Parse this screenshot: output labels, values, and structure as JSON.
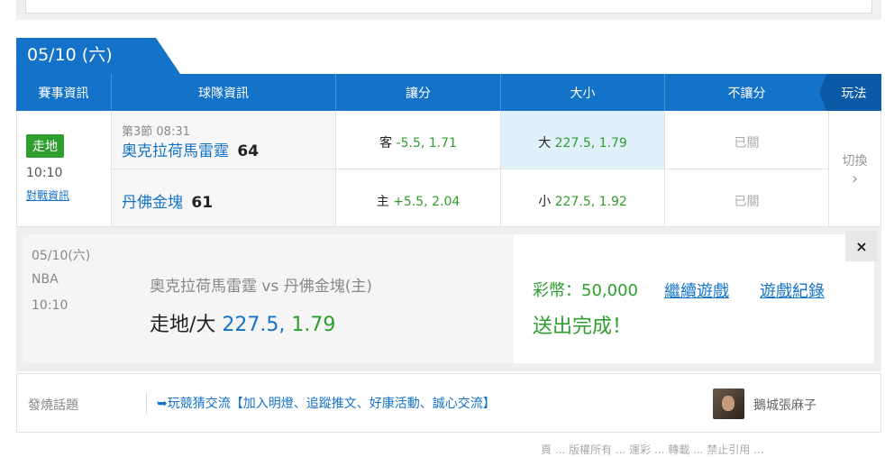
{
  "date_tab": "05/10 (六)",
  "headers": {
    "event_info": "賽事資訊",
    "team_info": "球隊資訊",
    "spread": "讓分",
    "over_under": "大小",
    "moneyline": "不讓分",
    "play": "玩法"
  },
  "match": {
    "status_badge": "走地",
    "time": "10:10",
    "matchup_link": "對戰資訊",
    "period": "第3節 08:31",
    "away": {
      "name": "奧克拉荷馬雷霆",
      "score": "64"
    },
    "home": {
      "name": "丹佛金塊",
      "score": "61"
    },
    "spread_away": {
      "label": "客",
      "value": "-5.5, 1.71"
    },
    "spread_home": {
      "label": "主",
      "value": "+5.5, 2.04"
    },
    "ou_over": {
      "label": "大",
      "value": "227.5, 1.79"
    },
    "ou_under": {
      "label": "小",
      "value": "227.5, 1.92"
    },
    "ml_away": "已關",
    "ml_home": "已關",
    "switch_label": "切換",
    "switch_arrow": "›"
  },
  "ticket": {
    "date": "05/10(六)",
    "league": "NBA",
    "time": "10:10",
    "matchup": "奧克拉荷馬雷霆  vs  丹佛金塊(主)",
    "bet_type": "走地/大",
    "bet_value": "227.5,",
    "bet_odds": "1.79",
    "credits": "彩幣：50,000",
    "continue_link": "繼續遊戲",
    "history_link": "遊戲紀錄",
    "status": "送出完成！",
    "close_label": "×"
  },
  "topic": {
    "label": "發燒話題",
    "link": "➥玩競猜交流【加入明燈、追蹤推文、好康活動、誠心交流】",
    "author": "鵝城張麻子"
  },
  "footer": {
    "text": "頁 ... 版權所有 ... 運彩 ... 轉載 ... 禁止引用 ..."
  },
  "colors": {
    "primary_blue": "#1472c8",
    "dark_blue": "#0b5aa6",
    "green": "#2e9e2e",
    "highlight": "#e1f1fb"
  }
}
